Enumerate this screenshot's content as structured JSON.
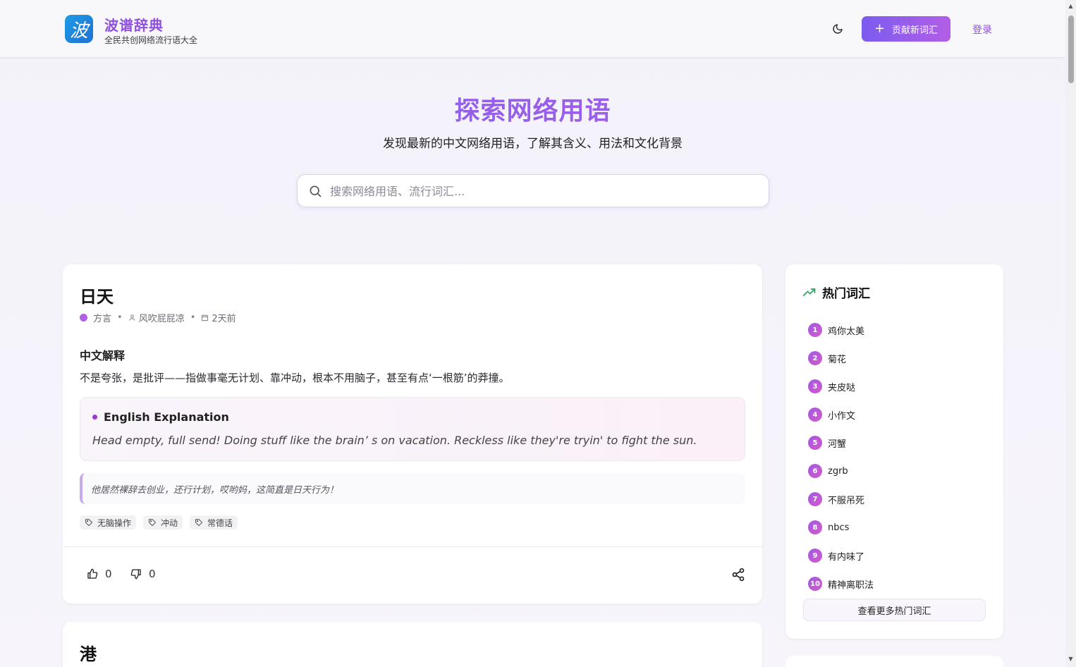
{
  "header": {
    "logo_char": "波",
    "brand_title": "波谱辞典",
    "brand_subtitle": "全民共创网络流行语大全",
    "contribute_label": "贡献新词汇",
    "login_label": "登录"
  },
  "hero": {
    "title": "探索网络用语",
    "subtitle": "发现最新的中文网络用语，了解其含义、用法和文化背景",
    "search_placeholder": "搜索网络用语、流行词汇..."
  },
  "entry": {
    "word": "日天",
    "category": "方言",
    "author": "风吹屁屁凉",
    "time": "2天前",
    "cn_label": "中文解释",
    "cn_definition": "不是夸张，是批评——指做事毫无计划、靠冲动，根本不用脑子，甚至有点‘一根筋’的莽撞。",
    "en_label": "English Explanation",
    "en_definition": "Head empty, full send! Doing stuff like the brain’ s on vacation. Reckless like they're tryin' to fight the sun.",
    "example": "他居然裸辞去创业，还行计划，哎哟妈，这简直是日天行为！",
    "tags": [
      "无脑操作",
      "冲动",
      "常德话"
    ],
    "likes": "0",
    "dislikes": "0"
  },
  "entry2": {
    "word": "港"
  },
  "sidebar": {
    "title": "热门词汇",
    "items": [
      {
        "rank": "1",
        "label": "鸡你太美"
      },
      {
        "rank": "2",
        "label": "菊花"
      },
      {
        "rank": "3",
        "label": "夹皮哒"
      },
      {
        "rank": "4",
        "label": "小作文"
      },
      {
        "rank": "5",
        "label": "河蟹"
      },
      {
        "rank": "6",
        "label": "zgrb"
      },
      {
        "rank": "7",
        "label": "不服吊死"
      },
      {
        "rank": "8",
        "label": "nbcs"
      },
      {
        "rank": "9",
        "label": "有内味了"
      },
      {
        "rank": "10",
        "label": "精神离职法"
      }
    ],
    "more_label": "查看更多热门词汇"
  },
  "colors": {
    "accent": "#8f4fe0",
    "gradient_start": "#7c5cf0",
    "gradient_end": "#b25ee6",
    "trend_green": "#22a55b"
  }
}
